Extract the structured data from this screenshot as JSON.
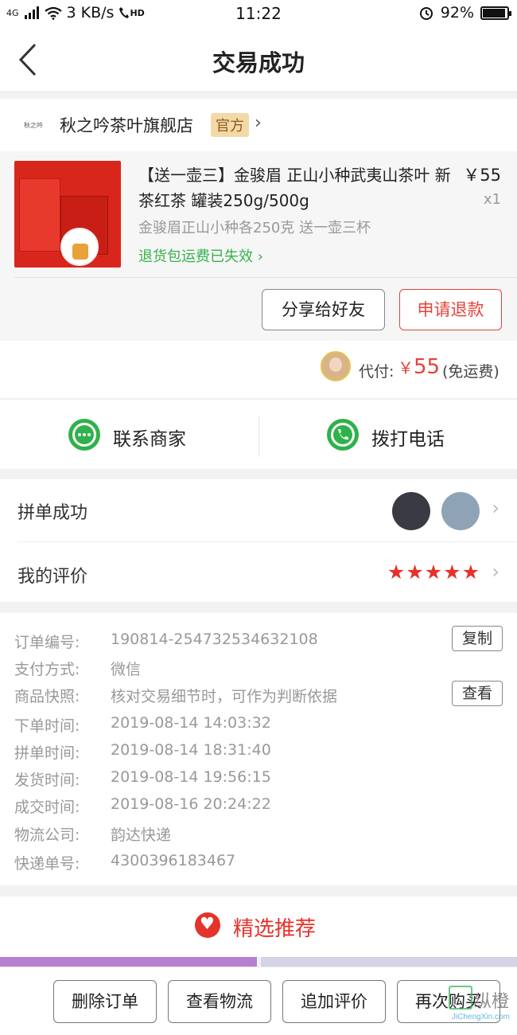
{
  "status_bar": {
    "network": "4G",
    "speed": "3 KB/s",
    "hd": "HD",
    "time": "11:22",
    "battery_percent": "92%",
    "battery_level": 0.92
  },
  "nav": {
    "title": "交易成功"
  },
  "shop": {
    "name": "秋之吟茶叶旗舰店",
    "badge": "官方",
    "logo_text": "秋之吟"
  },
  "product": {
    "title": "【送一壶三】金骏眉 正山小种武夷山茶叶 新茶红茶 罐装250g/500g",
    "price": "￥55",
    "qty": "x1",
    "spec": "金骏眉正山小种各250克 送一壶三杯",
    "refund_notice": "退货包运费已失效",
    "share_button": "分享给好友",
    "refund_button": "申请退款"
  },
  "payment": {
    "label": "代付:",
    "currency": "￥",
    "amount": "55",
    "shipping": "(免运费)"
  },
  "contact": {
    "merchant": "联系商家",
    "phone": "拨打电话"
  },
  "group": {
    "label": "拼单成功",
    "review_label": "我的评价",
    "rating": 5
  },
  "order_info": {
    "order_no_label": "订单编号:",
    "order_no": "190814-254732534632108",
    "copy_button": "复制",
    "pay_method_label": "支付方式:",
    "pay_method": "微信",
    "snapshot_label": "商品快照:",
    "snapshot": "核对交易细节时，可作为判断依据",
    "view_button": "查看",
    "order_time_label": "下单时间:",
    "order_time": "2019-08-14 14:03:32",
    "group_time_label": "拼单时间:",
    "group_time": "2019-08-14 18:31:40",
    "ship_time_label": "发货时间:",
    "ship_time": "2019-08-14 19:56:15",
    "deal_time_label": "成交时间:",
    "deal_time": "2019-08-16 20:24:22",
    "courier_label": "物流公司:",
    "courier": "韵达快递",
    "tracking_label": "快递单号:",
    "tracking": "4300396183467"
  },
  "recommend": {
    "title": "精选推荐"
  },
  "bottom_bar": {
    "delete": "删除订单",
    "logistics": "查看物流",
    "add_review": "追加评价",
    "rebuy": "再次购买"
  },
  "watermark": {
    "text": "纵橙",
    "sub": "JiChengXin.com"
  },
  "colors": {
    "accent": "#e5433a",
    "green": "#2fb14b",
    "star": "#e5322a"
  }
}
